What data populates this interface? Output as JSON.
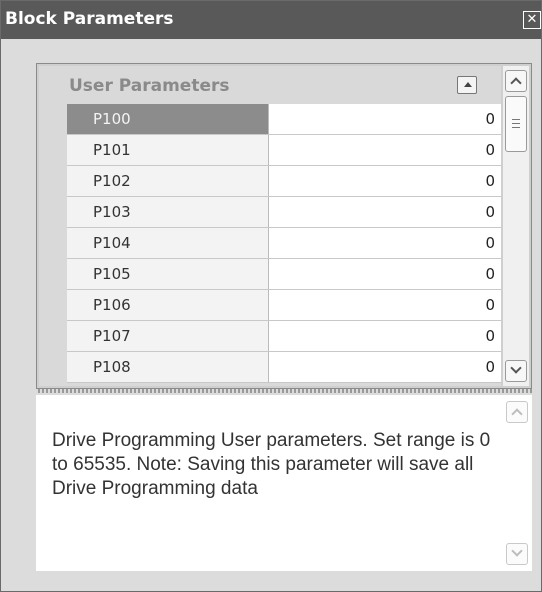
{
  "window": {
    "title": "Block Parameters",
    "close_glyph": "✕"
  },
  "grid": {
    "category": "User Parameters",
    "selected_row": 0,
    "rows": [
      {
        "name": "P100",
        "value": "0"
      },
      {
        "name": "P101",
        "value": "0"
      },
      {
        "name": "P102",
        "value": "0"
      },
      {
        "name": "P103",
        "value": "0"
      },
      {
        "name": "P104",
        "value": "0"
      },
      {
        "name": "P105",
        "value": "0"
      },
      {
        "name": "P106",
        "value": "0"
      },
      {
        "name": "P107",
        "value": "0"
      },
      {
        "name": "P108",
        "value": "0"
      }
    ]
  },
  "description": {
    "text": "Drive Programming User parameters. Set range is 0 to 65535. Note: Saving this parameter will save all Drive Programming data"
  },
  "icons": {
    "collapse": "chevron-up-icon",
    "scroll_up": "chevron-up-icon",
    "scroll_down": "chevron-down-icon",
    "close": "close-icon"
  },
  "colors": {
    "titlebar": "#595959",
    "selected_row": "#8c8c8c",
    "category_text": "#8a8a8a"
  }
}
